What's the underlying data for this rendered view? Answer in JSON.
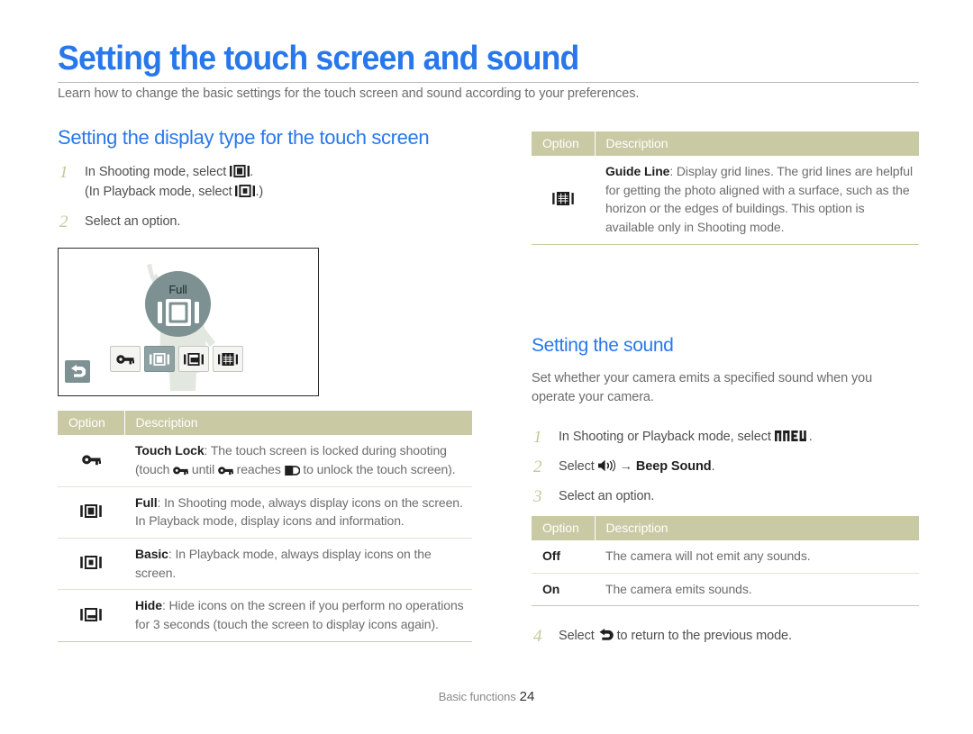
{
  "header": {
    "title": "Setting the touch screen and sound",
    "intro": "Learn how to change the basic settings for the touch screen and sound according to your preferences."
  },
  "colors": {
    "heading_blue": "#2878ec",
    "table_header_khaki": "#c9c9a4",
    "step_number": "#c5c79b",
    "bubble_teal": "#7d9193",
    "body_text": "#6d6d6d"
  },
  "left_column": {
    "section_heading": "Setting the display type for the touch screen",
    "steps": [
      {
        "num": "1",
        "text_before": "In Shooting mode, select ",
        "icon": "display-full-icon",
        "text_after": ".",
        "sub_before": "(In Playback mode, select ",
        "sub_icon": "display-basic-icon",
        "sub_after": ".)"
      },
      {
        "num": "2",
        "text_before": "Select an option.",
        "icon": "",
        "text_after": ""
      }
    ],
    "screen_illustration": {
      "bubble_label": "Full",
      "bubble_icon": "display-full-icon",
      "options": [
        {
          "icon": "key-lock-icon",
          "selected": false
        },
        {
          "icon": "display-full-icon",
          "selected": true
        },
        {
          "icon": "display-basic-icon",
          "selected": false
        },
        {
          "icon": "grid-lines-icon",
          "selected": false
        }
      ],
      "back_icon": "back-arrow-icon"
    },
    "table": {
      "headers": [
        "Option",
        "Description"
      ],
      "rows": [
        {
          "icon": "key-lock-icon",
          "term": "Touch Lock",
          "desc_1": ": The touch screen is locked during shooting (touch ",
          "desc_2": " until ",
          "desc_3": " reaches ",
          "desc_4": " to unlock the touch screen).",
          "inline_icons": [
            "key-lock-icon",
            "key-lock-icon",
            "unlock-slider-icon"
          ]
        },
        {
          "icon": "display-full-icon",
          "term": "Full",
          "desc_1": ": In Shooting mode, always display icons on the screen. In Playback mode, display icons and information."
        },
        {
          "icon": "display-basic-icon",
          "term": "Basic",
          "desc_1": ": In Playback mode, always display icons on the screen."
        },
        {
          "icon": "display-hide-icon",
          "term": "Hide",
          "desc_1": ": Hide icons on the screen if you perform no operations for 3 seconds (touch the screen to display icons again)."
        }
      ]
    }
  },
  "right_column": {
    "guide_table": {
      "headers": [
        "Option",
        "Description"
      ],
      "rows": [
        {
          "icon": "grid-lines-icon",
          "term": "Guide Line",
          "desc_1": ": Display grid lines. The grid lines are helpful for getting the photo aligned with a surface, such as the horizon or the edges of buildings. This option is available only in Shooting mode."
        }
      ]
    },
    "sound_section": {
      "heading": "Setting the sound",
      "body": "Set whether your camera emits a specified sound when you operate your camera.",
      "steps": [
        {
          "num": "1",
          "text_before": "In Shooting or Playback mode, select ",
          "icon": "menu-icon",
          "icon_text": "MENU",
          "text_after": "."
        },
        {
          "num": "2",
          "text_before": "Select ",
          "icon": "speaker-icon",
          "text_mid": " → ",
          "bold_text": "Beep Sound",
          "text_after": "."
        },
        {
          "num": "3",
          "text_before": "Select an option.",
          "icon": "",
          "text_after": ""
        }
      ],
      "table": {
        "headers": [
          "Option",
          "Description"
        ],
        "rows": [
          {
            "option": "Off",
            "desc": "The camera will not emit any sounds."
          },
          {
            "option": "On",
            "desc": "The camera emits sounds."
          }
        ]
      },
      "final_step": {
        "num": "4",
        "text_before": "Select ",
        "icon": "back-arrow-icon",
        "text_after": " to return to the previous mode."
      }
    }
  },
  "footer": {
    "section": "Basic functions",
    "page_number": "24"
  }
}
